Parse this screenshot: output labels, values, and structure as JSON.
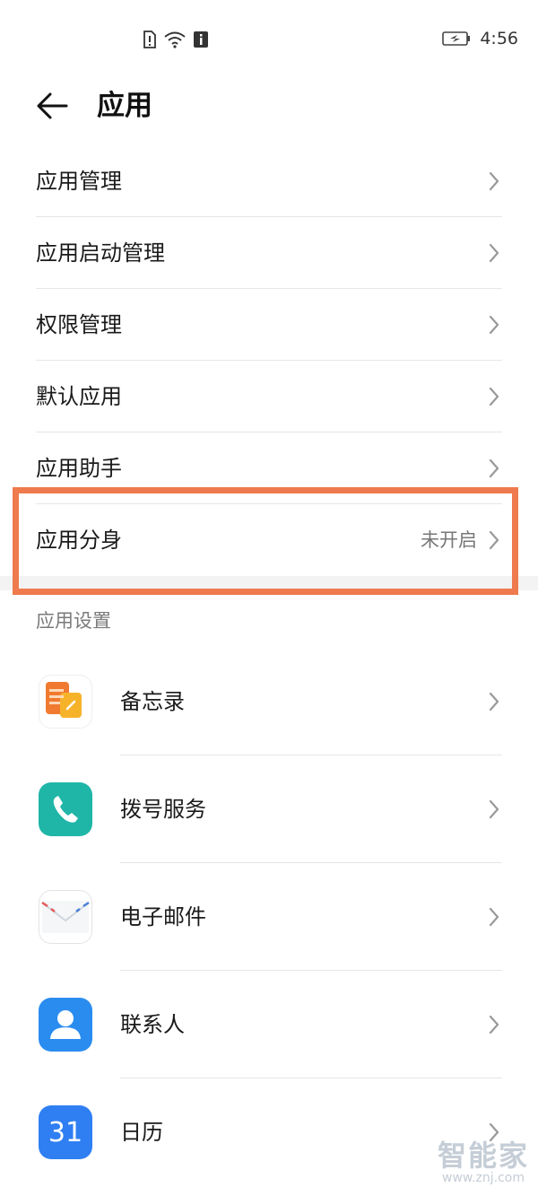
{
  "status_bar": {
    "time": "4:56",
    "icons": [
      "sim-alert-icon",
      "wifi-icon",
      "info-icon",
      "battery-icon"
    ]
  },
  "header": {
    "title": "应用",
    "back_icon": "arrow-left-icon"
  },
  "rows": [
    {
      "label": "应用管理"
    },
    {
      "label": "应用启动管理"
    },
    {
      "label": "权限管理"
    },
    {
      "label": "默认应用"
    },
    {
      "label": "应用助手"
    },
    {
      "label": "应用分身",
      "value": "未开启",
      "highlighted": true
    }
  ],
  "section": {
    "title": "应用设置"
  },
  "apps": [
    {
      "label": "备忘录",
      "icon": "notes-icon"
    },
    {
      "label": "拨号服务",
      "icon": "phone-icon"
    },
    {
      "label": "电子邮件",
      "icon": "email-icon"
    },
    {
      "label": "联系人",
      "icon": "contacts-icon"
    },
    {
      "label": "日历",
      "icon": "calendar-icon",
      "icon_text": "31"
    }
  ],
  "watermark": {
    "title": "智能家",
    "url": "www.znj.com"
  },
  "colors": {
    "highlight": "#ee7a4d",
    "divider": "#e6e6e6",
    "phone_app": "#1fb6a8",
    "contacts_app": "#2b8cf0",
    "calendar_app": "#2f7ff2"
  }
}
